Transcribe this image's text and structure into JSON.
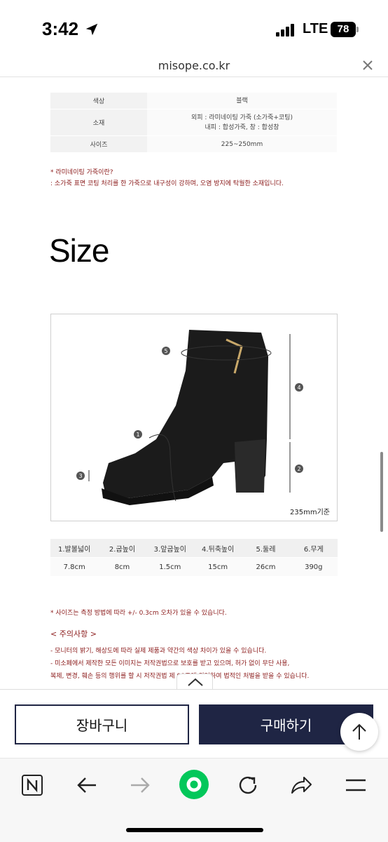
{
  "status": {
    "time": "3:42",
    "network": "LTE",
    "battery": "78"
  },
  "browser": {
    "url": "misope.co.kr"
  },
  "spec_table": {
    "rows": [
      {
        "key": "색상",
        "values": [
          "블랙"
        ]
      },
      {
        "key": "소재",
        "values": [
          "외피 : 라미네이팅 가죽 (소가죽+코팅)",
          "내피 : 합성가죽, 창 : 합성창"
        ]
      },
      {
        "key": "사이즈",
        "values": [
          "225~250mm"
        ]
      }
    ]
  },
  "laminating_note": {
    "title": "* 라미네이팅 가죽이란?",
    "text": ": 소가죽 표면 코팅 처리를 한 가죽으로 내구성이 강하며, 오염 방지에 탁월한 소재입니다."
  },
  "size_section": {
    "heading": "Size",
    "image_caption": "235mm기준",
    "markers": [
      "1",
      "2",
      "3",
      "4",
      "5"
    ],
    "columns": [
      "1.발볼넓이",
      "2.굽높이",
      "3.앞굽높이",
      "4.뒤축높이",
      "5.둘레",
      "6.무게"
    ],
    "values": [
      "7.8cm",
      "8cm",
      "1.5cm",
      "15cm",
      "26cm",
      "390g"
    ],
    "note": "* 사이즈는 측정 방법에 따라 +/- 0.3cm 오차가 있을 수 있습니다."
  },
  "caution": {
    "title": "< 주의사항 >",
    "lines": [
      "- 모니터의 밝기, 해상도에 따라 실제 제품과 약간의 색상 차이가 있을 수 있습니다.",
      "- 미소페에서 제작한 모든 이미지는 저작권법으로 보호를 받고 있으며, 허가 없이 무단 사용,",
      "복제, 변경, 훼손 등의 행위를 할 시 저작권법 제 98조에 의거하여 법적인 처벌을 받을 수 있습니다."
    ]
  },
  "purchase": {
    "cart_label": "장바구니",
    "buy_label": "구매하기"
  },
  "colors": {
    "navy": "#1f2544",
    "note_red": "#8b1a1a",
    "naver_green": "#03c75a"
  },
  "icons": [
    "location-arrow-icon",
    "signal-icon",
    "battery-icon",
    "close-icon",
    "chevron-up-icon",
    "arrow-up-icon",
    "naver-n-icon",
    "back-arrow-icon",
    "forward-arrow-icon",
    "naver-home-icon",
    "refresh-icon",
    "share-icon",
    "menu-icon"
  ]
}
